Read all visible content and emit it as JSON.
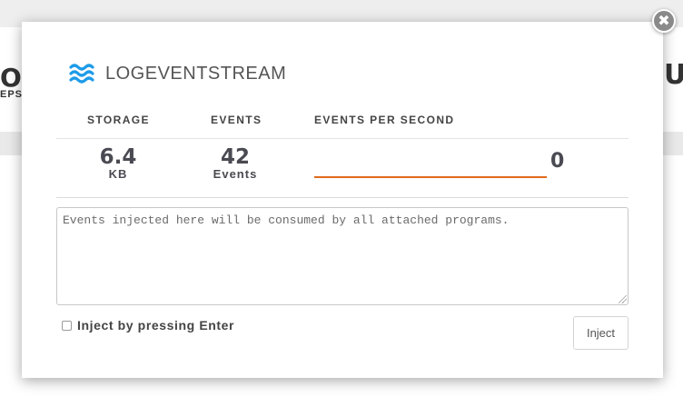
{
  "background": {
    "left_number": "O",
    "left_unit": "EPS",
    "right_text": "UN"
  },
  "modal": {
    "close_glyph": "✖",
    "brand": {
      "title": "LOGEVENTSTREAM",
      "icon": "waves-icon",
      "icon_color": "#1e9be8"
    },
    "columns": {
      "storage": "STORAGE",
      "events": "EVENTS",
      "events_per_second": "EVENTS PER SECOND"
    },
    "stats": {
      "storage_value": "6.4",
      "storage_unit": "KB",
      "events_value": "42",
      "events_unit": "Events",
      "eps_value": "0",
      "eps_line_color": "#e06a1c"
    },
    "inject": {
      "placeholder": "Events injected here will be consumed by all attached programs.",
      "value": "",
      "enter_label": "Inject by pressing Enter",
      "enter_checked": false,
      "button_label": "Inject"
    }
  }
}
